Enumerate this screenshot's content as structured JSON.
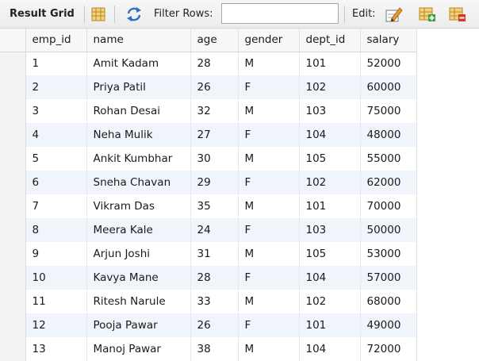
{
  "toolbar": {
    "title": "Result Grid",
    "filter_label": "Filter Rows:",
    "filter_value": "",
    "edit_label": "Edit:",
    "icons": [
      "grid-layout-icon",
      "refresh-icon",
      "edit-row-icon",
      "add-row-icon",
      "delete-row-icon"
    ]
  },
  "grid": {
    "columns": [
      "emp_id",
      "name",
      "age",
      "gender",
      "dept_id",
      "salary"
    ],
    "rows": [
      [
        "1",
        "Amit Kadam",
        "28",
        "M",
        "101",
        "52000"
      ],
      [
        "2",
        "Priya Patil",
        "26",
        "F",
        "102",
        "60000"
      ],
      [
        "3",
        "Rohan Desai",
        "32",
        "M",
        "103",
        "75000"
      ],
      [
        "4",
        "Neha Mulik",
        "27",
        "F",
        "104",
        "48000"
      ],
      [
        "5",
        "Ankit Kumbhar",
        "30",
        "M",
        "105",
        "55000"
      ],
      [
        "6",
        "Sneha Chavan",
        "29",
        "F",
        "102",
        "62000"
      ],
      [
        "7",
        "Vikram Das",
        "35",
        "M",
        "101",
        "70000"
      ],
      [
        "8",
        "Meera Kale",
        "24",
        "F",
        "103",
        "50000"
      ],
      [
        "9",
        "Arjun Joshi",
        "31",
        "M",
        "105",
        "53000"
      ],
      [
        "10",
        "Kavya Mane",
        "28",
        "F",
        "104",
        "57000"
      ],
      [
        "11",
        "Ritesh Narule",
        "33",
        "M",
        "102",
        "68000"
      ],
      [
        "12",
        "Pooja Pawar",
        "26",
        "F",
        "101",
        "49000"
      ],
      [
        "13",
        "Manoj Pawar",
        "38",
        "M",
        "104",
        "72000"
      ]
    ]
  },
  "colors": {
    "alt_row": "#f0f4fb",
    "toolbar_bg": "#ececec",
    "refresh_blue": "#2f6fc4",
    "edit_orange": "#e69a2a"
  }
}
